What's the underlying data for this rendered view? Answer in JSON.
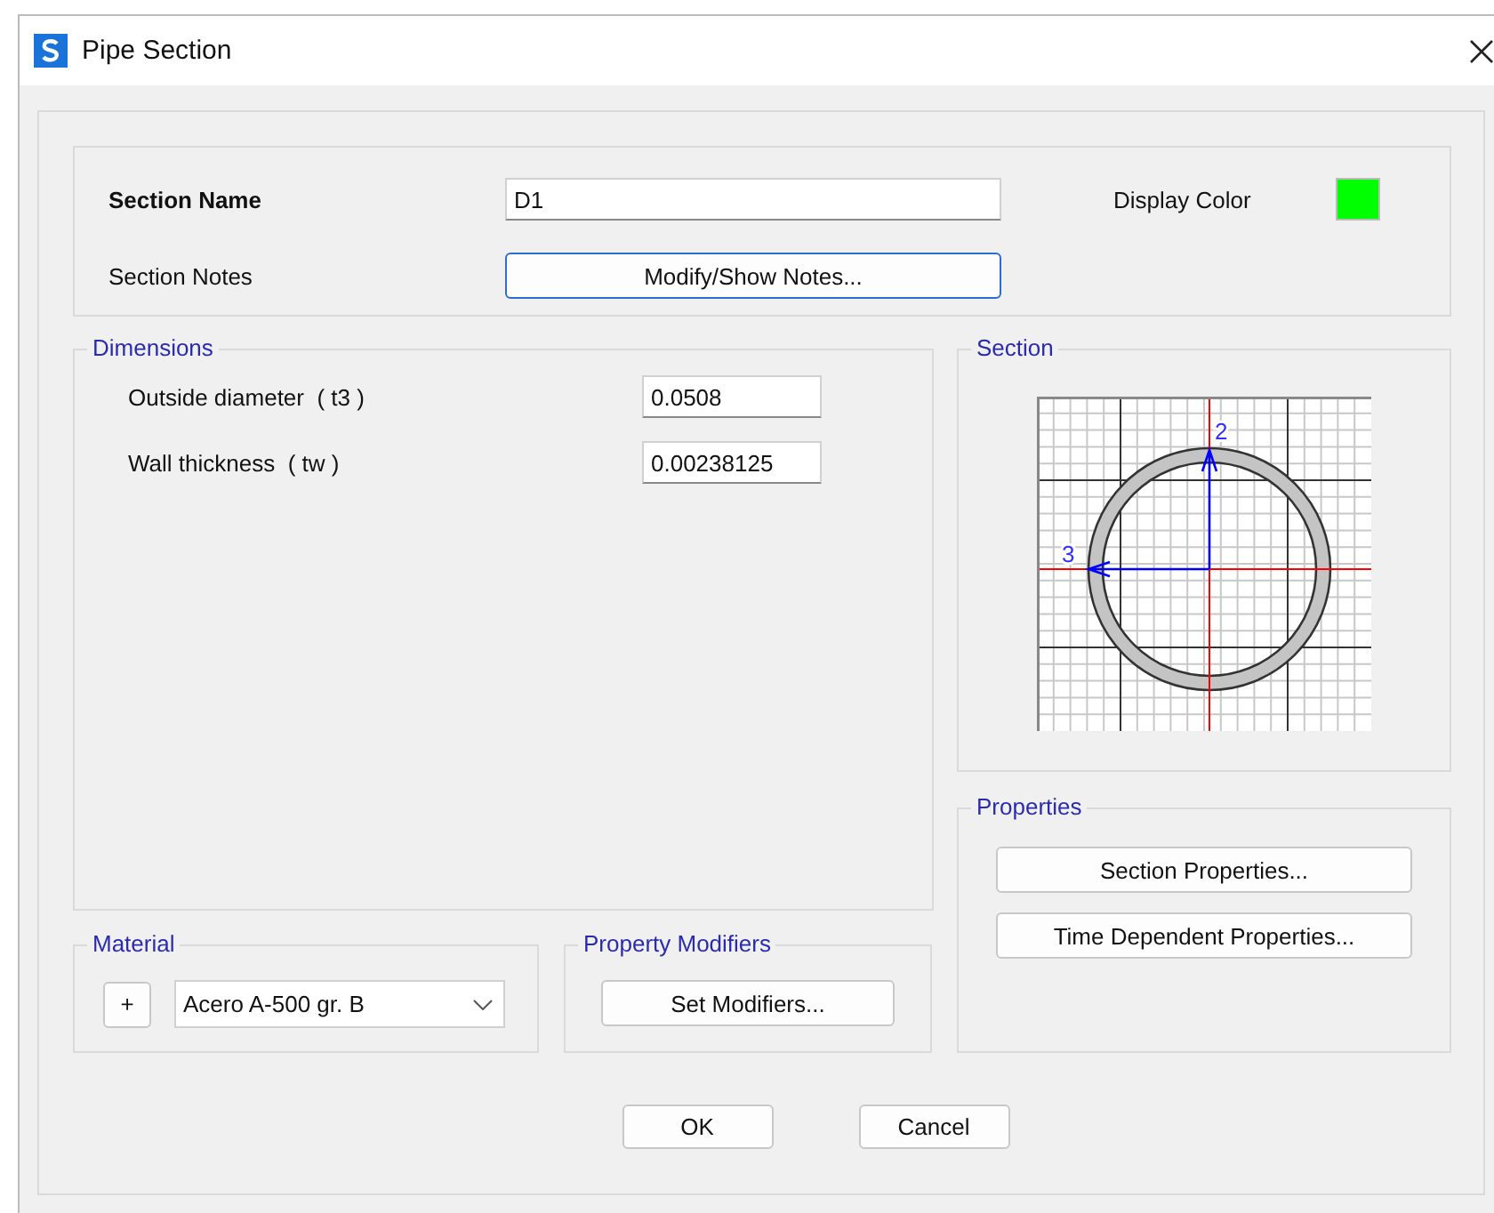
{
  "window": {
    "title": "Pipe Section"
  },
  "section_name": {
    "label": "Section Name",
    "value": "D1"
  },
  "section_notes": {
    "label": "Section Notes",
    "button": "Modify/Show Notes..."
  },
  "display_color": {
    "label": "Display Color",
    "color": "#00ff00"
  },
  "dimensions": {
    "title": "Dimensions",
    "fields": [
      {
        "label": "Outside diameter  ( t3 )",
        "value": "0.0508"
      },
      {
        "label": "Wall thickness  ( tw )",
        "value": "0.00238125"
      }
    ]
  },
  "section_view": {
    "title": "Section",
    "axis_labels": [
      "2",
      "3"
    ]
  },
  "properties": {
    "title": "Properties",
    "buttons": [
      "Section Properties...",
      "Time Dependent Properties..."
    ]
  },
  "material": {
    "title": "Material",
    "add_button": "+",
    "value": "Acero A-500 gr. B"
  },
  "property_modifiers": {
    "title": "Property Modifiers",
    "button": "Set Modifiers..."
  },
  "buttons": [
    "OK",
    "Cancel"
  ]
}
